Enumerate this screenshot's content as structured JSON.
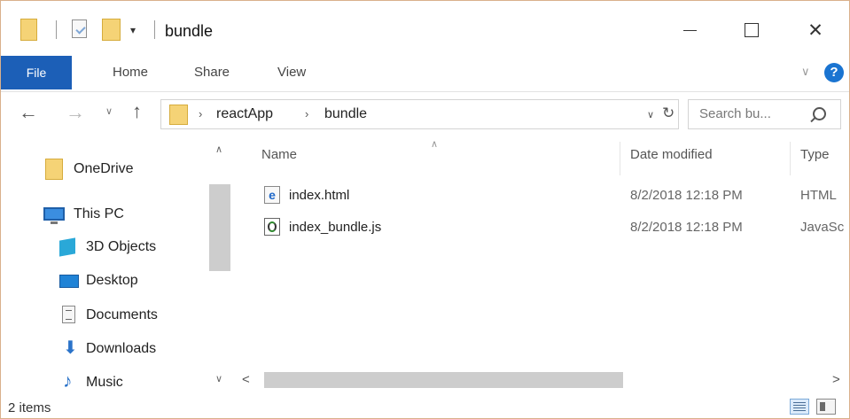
{
  "window": {
    "title": "bundle",
    "quick_access_dropdown": "▾",
    "close_glyph": "✕"
  },
  "ribbon": {
    "tabs": [
      "File",
      "Home",
      "Share",
      "View"
    ],
    "collapse_glyph": "∨",
    "help_glyph": "?"
  },
  "address": {
    "back_glyph": "←",
    "forward_glyph": "→",
    "recent_glyph": "∨",
    "up_glyph": "↑",
    "breadcrumb_sep": "›",
    "breadcrumbs": [
      "reactApp",
      "bundle"
    ],
    "dropdown_glyph": "∨",
    "refresh_glyph": "↻"
  },
  "search": {
    "placeholder": "Search bu..."
  },
  "nav_pane": {
    "items": [
      {
        "label": "OneDrive",
        "icon": "onedrive-folder-icon"
      },
      {
        "label": "This PC",
        "icon": "computer-icon"
      },
      {
        "label": "3D Objects",
        "icon": "3d-objects-icon"
      },
      {
        "label": "Desktop",
        "icon": "desktop-icon"
      },
      {
        "label": "Documents",
        "icon": "documents-icon"
      },
      {
        "label": "Downloads",
        "icon": "downloads-icon"
      },
      {
        "label": "Music",
        "icon": "music-icon"
      }
    ],
    "scroll_up_glyph": "∧",
    "scroll_down_glyph": "∨",
    "downloads_glyph": "🡫",
    "music_glyph": "♪"
  },
  "file_list": {
    "columns": [
      "Name",
      "Date modified",
      "Type"
    ],
    "sort_glyph": "∧",
    "rows": [
      {
        "name": "index.html",
        "date": "8/2/2018 12:18 PM",
        "type": "HTML",
        "icon": "html-file-icon"
      },
      {
        "name": "index_bundle.js",
        "date": "8/2/2018 12:18 PM",
        "type": "JavaSc",
        "icon": "js-file-icon"
      }
    ],
    "hscroll_left_glyph": "<",
    "hscroll_right_glyph": ">"
  },
  "status": {
    "item_count": "2 items"
  },
  "colors": {
    "file_tab": "#1c5fb7",
    "folder_yellow": "#f5d376",
    "help_blue": "#1a74d1",
    "border": "#d9b08c"
  }
}
